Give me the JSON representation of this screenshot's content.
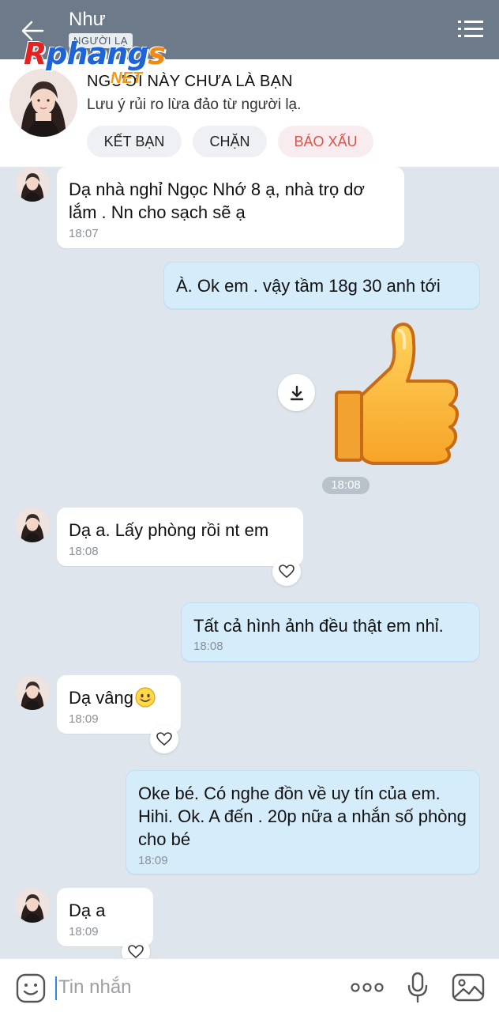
{
  "header": {
    "name": "Như",
    "tag": "NGƯỜI LẠ",
    "watermark_main": "Rphangs",
    "watermark_net": "NET"
  },
  "banner": {
    "title": "NGƯỜI NÀY CHƯA LÀ BẠN",
    "subtitle": "Lưu ý rủi ro lừa đảo từ người lạ.",
    "add_friend": "KẾT BẠN",
    "block": "CHẶN",
    "report": "BÁO XẤU"
  },
  "messages": [
    {
      "dir": "in",
      "text": "Dạ nhà nghỉ Ngọc Nhớ 8 ạ, nhà trọ dơ lắm . Nn cho sạch sẽ ạ",
      "time": "18:07"
    },
    {
      "dir": "out",
      "text": "À. Ok em . vậy tầm 18g 30 anh tới",
      "time": ""
    },
    {
      "dir": "out",
      "type": "sticker",
      "sticker": "thumbs-up",
      "time": "18:08"
    },
    {
      "dir": "in",
      "text": "Dạ a. Lấy phòng rồi nt em",
      "time": "18:08"
    },
    {
      "dir": "out",
      "text": "Tất cả hình ảnh đều thật em nhỉ.",
      "time": "18:08"
    },
    {
      "dir": "in",
      "text": "Dạ vâng",
      "emoji": "smiling-face",
      "time": "18:09"
    },
    {
      "dir": "out",
      "text": "Oke bé. Có nghe đồn về uy tín của em. Hihi. Ok. A đến . 20p nữa a nhắn số phòng cho bé",
      "time": "18:09"
    },
    {
      "dir": "in",
      "text": "Dạ a",
      "time": "18:09"
    }
  ],
  "input": {
    "placeholder": "Tin nhắn"
  },
  "colors": {
    "header": "#6c7a8a",
    "chat_bg": "#dfe5ec",
    "outgoing_bubble": "#d5ecfb",
    "incoming_bubble": "#ffffff",
    "report_red": "#d9534f"
  }
}
